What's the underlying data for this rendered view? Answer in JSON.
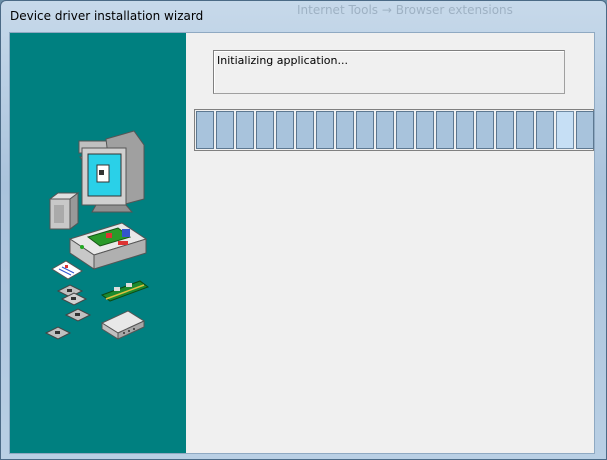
{
  "window": {
    "title": "Device driver installation wizard"
  },
  "background_window": {
    "title": "Internet Tools → Browser extensions"
  },
  "status": {
    "text": "Initializing application..."
  },
  "progress": {
    "segments_total": 20,
    "highlighted_segment": 19,
    "fraction_complete": 1.0
  },
  "colors": {
    "sidebar": "#008080",
    "progress_fill": "#a8c3dc",
    "client_bg": "#f0f0f0"
  },
  "icons": [
    "computer-monitor-icon",
    "speaker-icon",
    "pc-case-icon",
    "document-icon",
    "floppy-disk-icon",
    "expansion-card-icon",
    "modem-icon"
  ]
}
